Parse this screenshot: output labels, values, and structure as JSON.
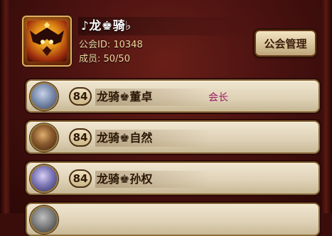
{
  "guild": {
    "name": "♪龙♚骑♭",
    "id_text": "公会ID: 10348",
    "members_text": "成员: 50/50",
    "manage_button": "公会管理"
  },
  "members": [
    {
      "level": "84",
      "name": "龙骑♚董卓",
      "role": "会长",
      "portrait_color": "#7d8fb0"
    },
    {
      "level": "84",
      "name": "龙骑♚自然",
      "role": "",
      "portrait_color": "#8a5a2e"
    },
    {
      "level": "84",
      "name": "龙骑♚孙权",
      "role": "",
      "portrait_color": "#7e78b8"
    }
  ],
  "colors": {
    "role": "#9a1a64",
    "button_text": "#3a1c0a"
  }
}
